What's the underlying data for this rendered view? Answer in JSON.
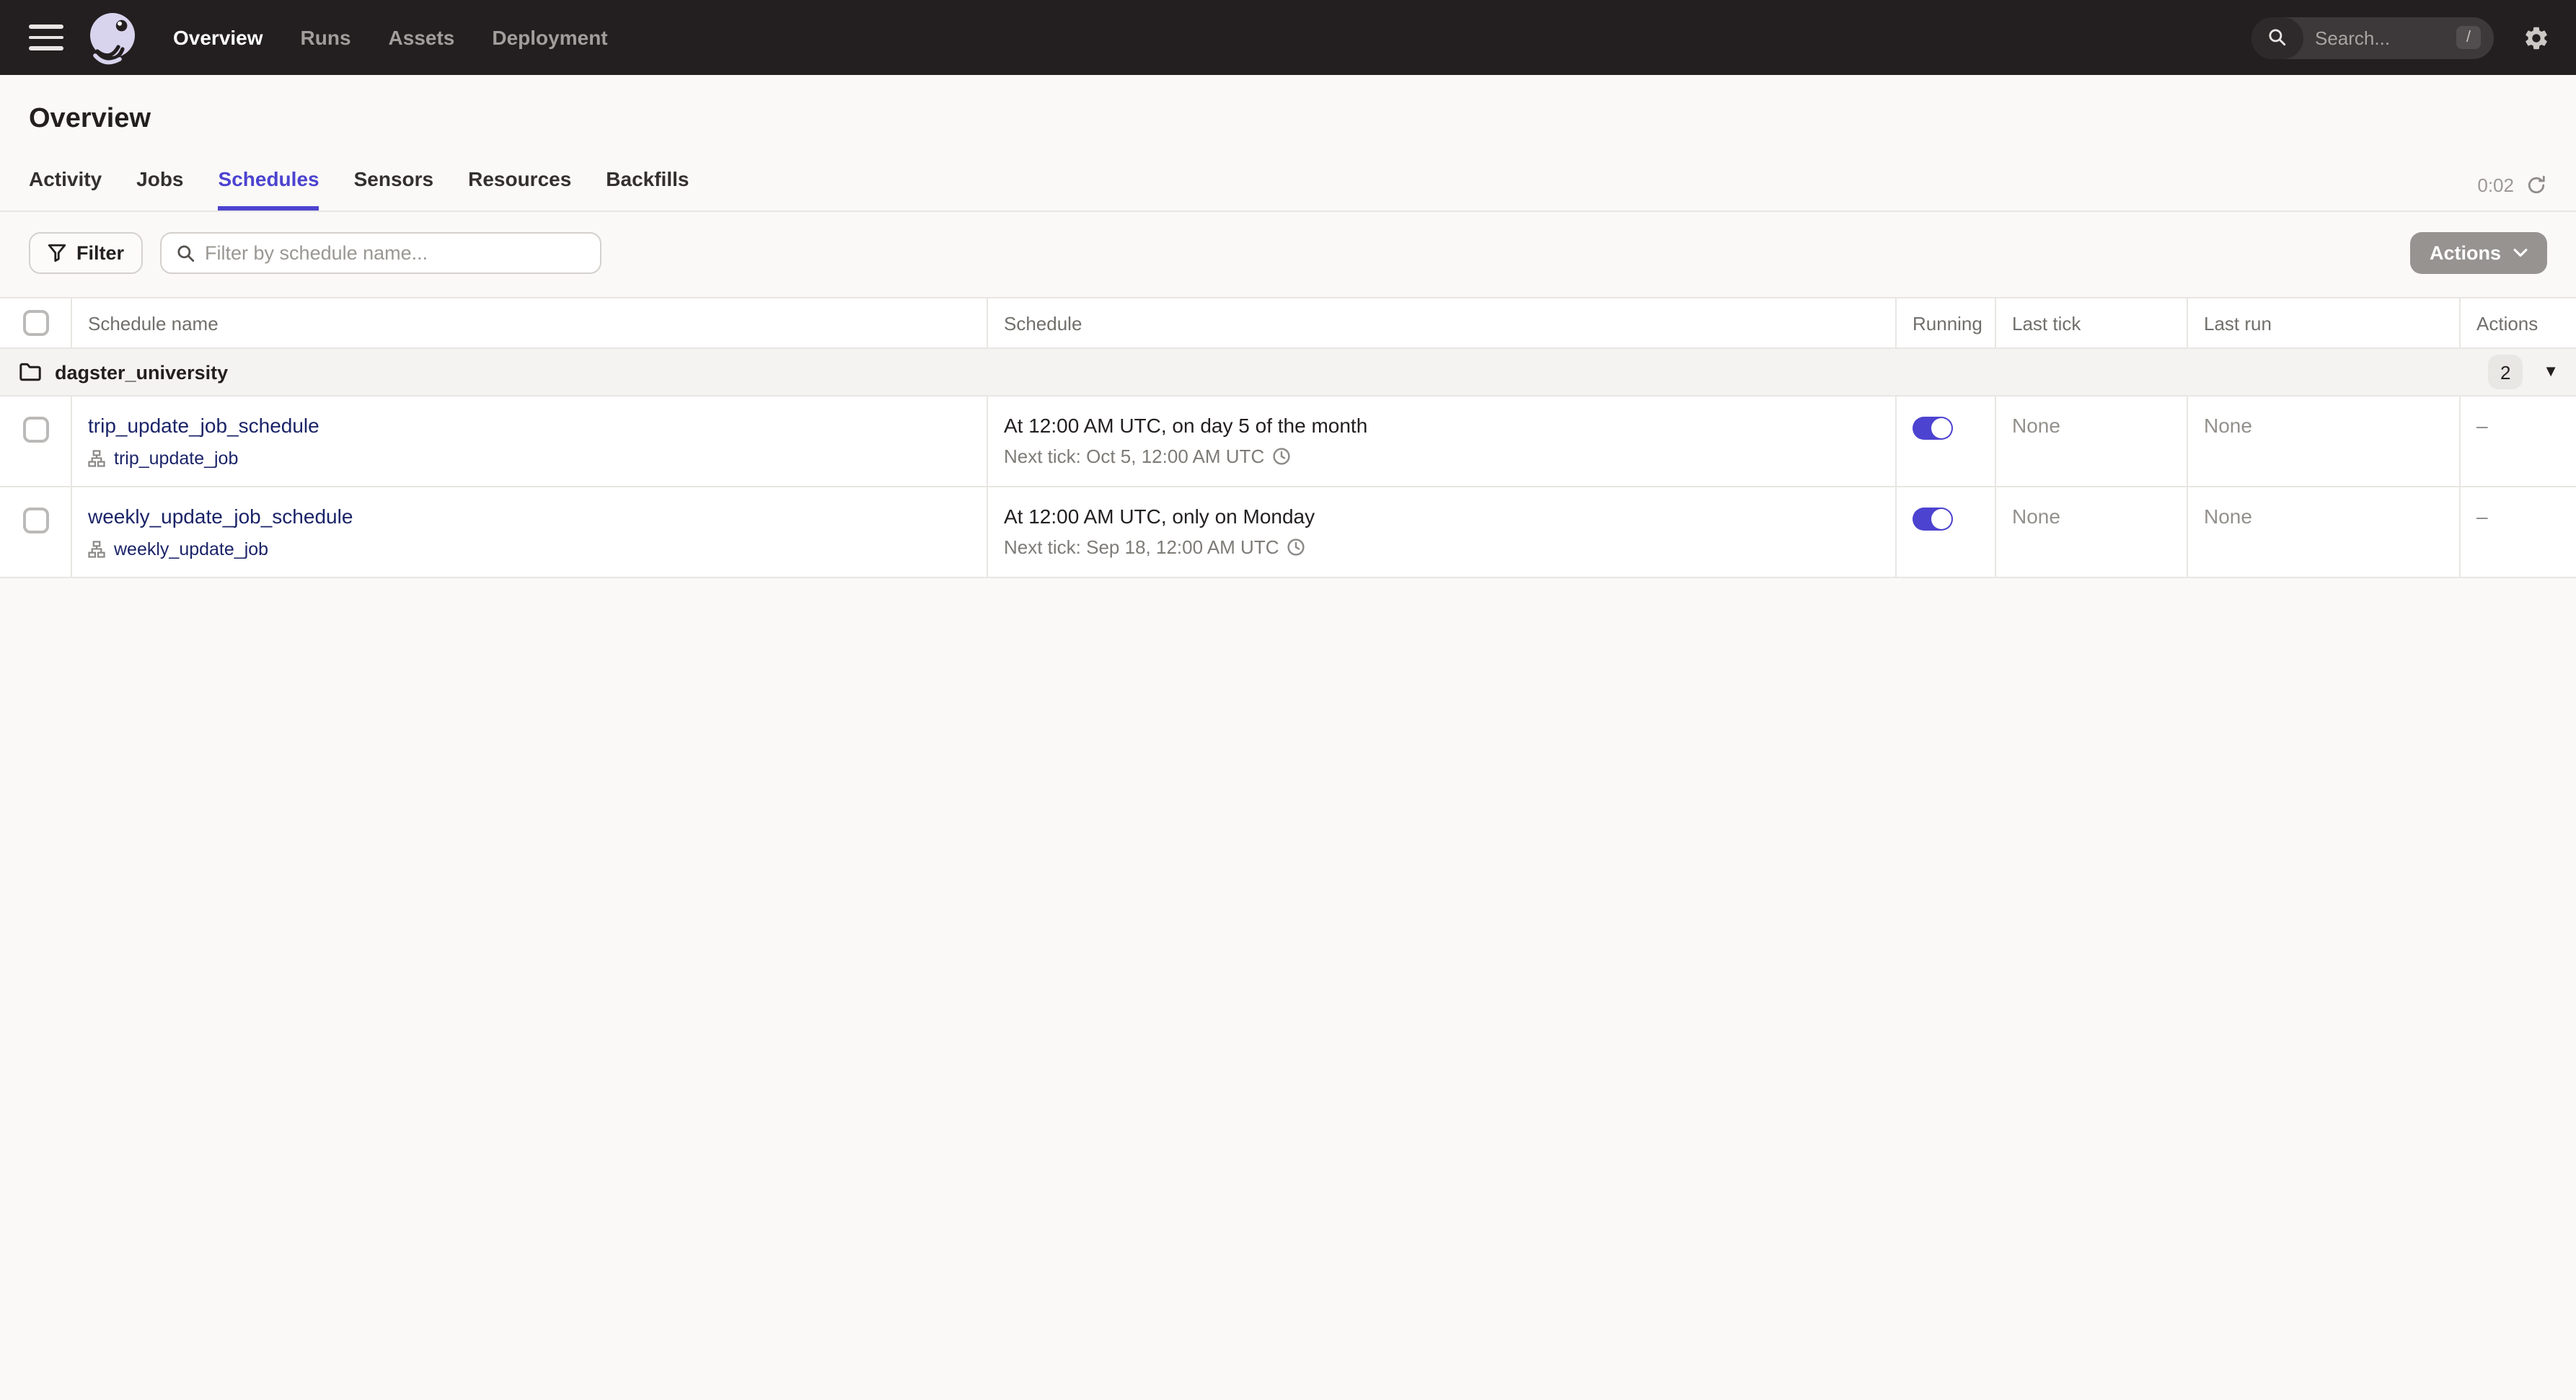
{
  "nav": {
    "items": [
      {
        "label": "Overview",
        "active": true
      },
      {
        "label": "Runs",
        "active": false
      },
      {
        "label": "Assets",
        "active": false
      },
      {
        "label": "Deployment",
        "active": false
      }
    ],
    "search": {
      "placeholder": "Search...",
      "shortcut": "/"
    }
  },
  "page": {
    "title": "Overview"
  },
  "tabs": {
    "items": [
      {
        "label": "Activity",
        "active": false
      },
      {
        "label": "Jobs",
        "active": false
      },
      {
        "label": "Schedules",
        "active": true
      },
      {
        "label": "Sensors",
        "active": false
      },
      {
        "label": "Resources",
        "active": false
      },
      {
        "label": "Backfills",
        "active": false
      }
    ],
    "refresh_countdown": "0:02"
  },
  "toolbar": {
    "filter_label": "Filter",
    "filter_placeholder": "Filter by schedule name...",
    "actions_label": "Actions"
  },
  "table": {
    "headers": {
      "name": "Schedule name",
      "schedule": "Schedule",
      "running": "Running",
      "last_tick": "Last tick",
      "last_run": "Last run",
      "actions": "Actions"
    },
    "group": {
      "name": "dagster_university",
      "count": "2"
    },
    "rows": [
      {
        "name": "trip_update_job_schedule",
        "job": "trip_update_job",
        "schedule": "At 12:00 AM UTC, on day 5 of the month",
        "next_tick": "Next tick: Oct 5, 12:00 AM UTC",
        "running": true,
        "last_tick": "None",
        "last_run": "None",
        "actions": "–"
      },
      {
        "name": "weekly_update_job_schedule",
        "job": "weekly_update_job",
        "schedule": "At 12:00 AM UTC, only on Monday",
        "next_tick": "Next tick: Sep 18, 12:00 AM UTC",
        "running": true,
        "last_tick": "None",
        "last_run": "None",
        "actions": "–"
      }
    ]
  },
  "colors": {
    "accent": "#4C43D0",
    "link": "#1B2468",
    "nav_bg": "#231F20",
    "toggle_on": "#4C43D0",
    "logo": "#D8D4EE"
  }
}
